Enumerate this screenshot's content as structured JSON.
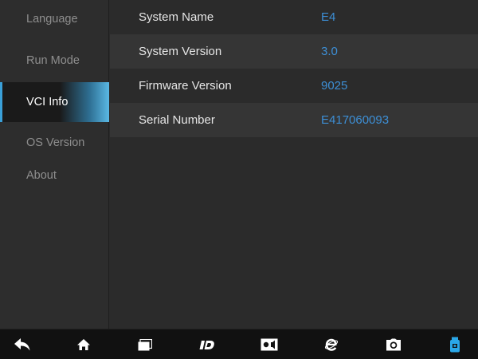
{
  "sidebar": {
    "items": [
      {
        "label": "Language"
      },
      {
        "label": "Run Mode"
      },
      {
        "label": "VCI Info",
        "active": true
      },
      {
        "label": "OS Version"
      },
      {
        "label": "About"
      }
    ]
  },
  "info": {
    "rows": [
      {
        "label": "System Name",
        "value": "E4"
      },
      {
        "label": "System Version",
        "value": "3.0"
      },
      {
        "label": "Firmware Version",
        "value": "9025"
      },
      {
        "label": "Serial Number",
        "value": "E417060093"
      }
    ]
  },
  "taskbar": {
    "icons": [
      "back-icon",
      "home-icon",
      "recent-apps-icon",
      "diagnostic-app-icon",
      "display-settings-icon",
      "browser-icon",
      "camera-icon",
      "vci-connection-icon"
    ]
  },
  "colors": {
    "accent": "#3d8fd6",
    "active_highlight": "#5ab8e4",
    "background": "#2b2b2b",
    "taskbar": "#111111",
    "vci_icon": "#2aa7e8"
  }
}
